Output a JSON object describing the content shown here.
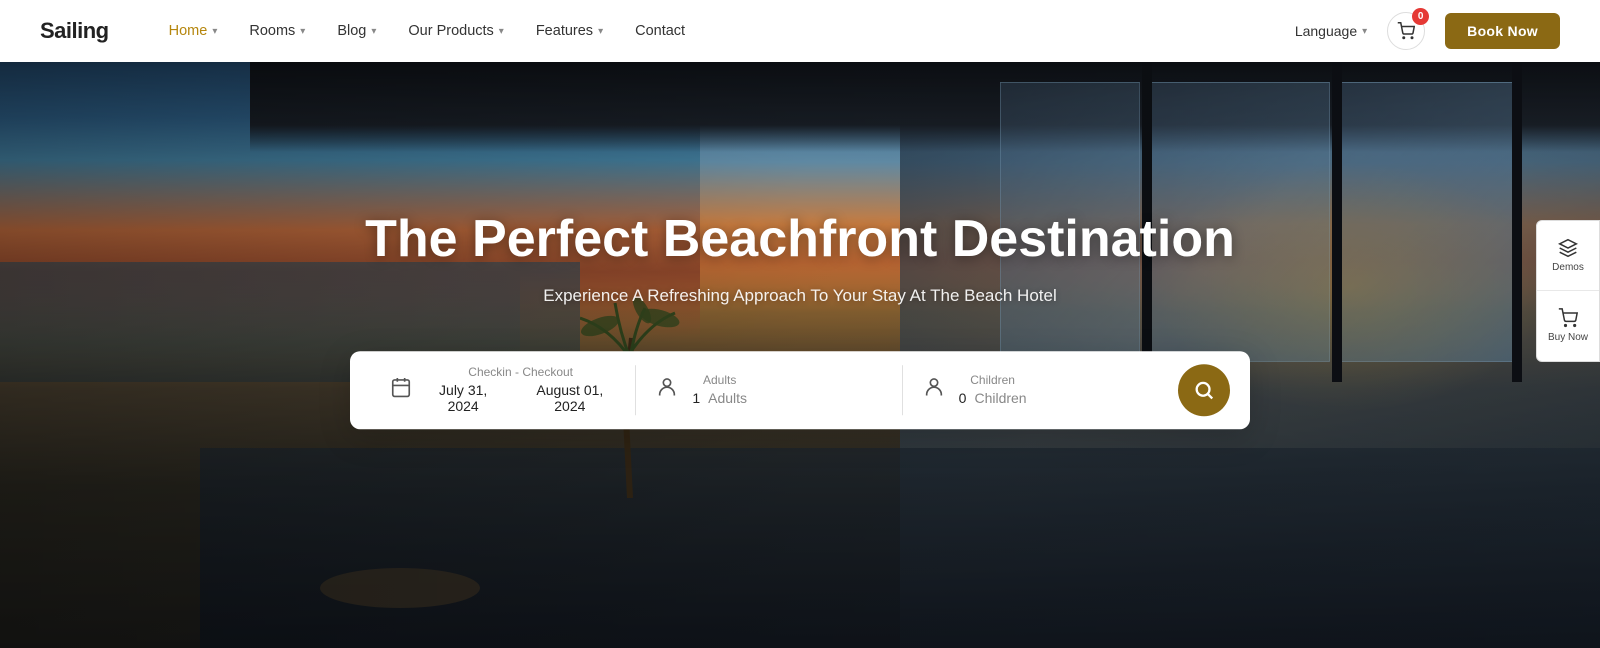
{
  "logo": "Sailing",
  "nav": {
    "items": [
      {
        "label": "Home",
        "active": true,
        "hasDropdown": true
      },
      {
        "label": "Rooms",
        "active": false,
        "hasDropdown": true
      },
      {
        "label": "Blog",
        "active": false,
        "hasDropdown": true
      },
      {
        "label": "Our Products",
        "active": false,
        "hasDropdown": true
      },
      {
        "label": "Features",
        "active": false,
        "hasDropdown": true
      },
      {
        "label": "Contact",
        "active": false,
        "hasDropdown": false
      }
    ],
    "language_label": "Language",
    "cart_badge": "0",
    "book_now": "Book Now"
  },
  "hero": {
    "title": "The Perfect Beachfront Destination",
    "subtitle": "Experience A Refreshing Approach To Your Stay At The Beach Hotel"
  },
  "search": {
    "checkin_label": "Checkin - Checkout",
    "checkin_date": "July 31, 2024",
    "checkout_date": "August 01, 2024",
    "adults_label": "Adults",
    "adults_count": "1",
    "adults_unit": "Adults",
    "children_label": "Children",
    "children_count": "0",
    "children_unit": "Children"
  },
  "side_panels": [
    {
      "icon": "layers-icon",
      "label": "Demos"
    },
    {
      "icon": "cart-icon",
      "label": "Buy Now"
    }
  ]
}
